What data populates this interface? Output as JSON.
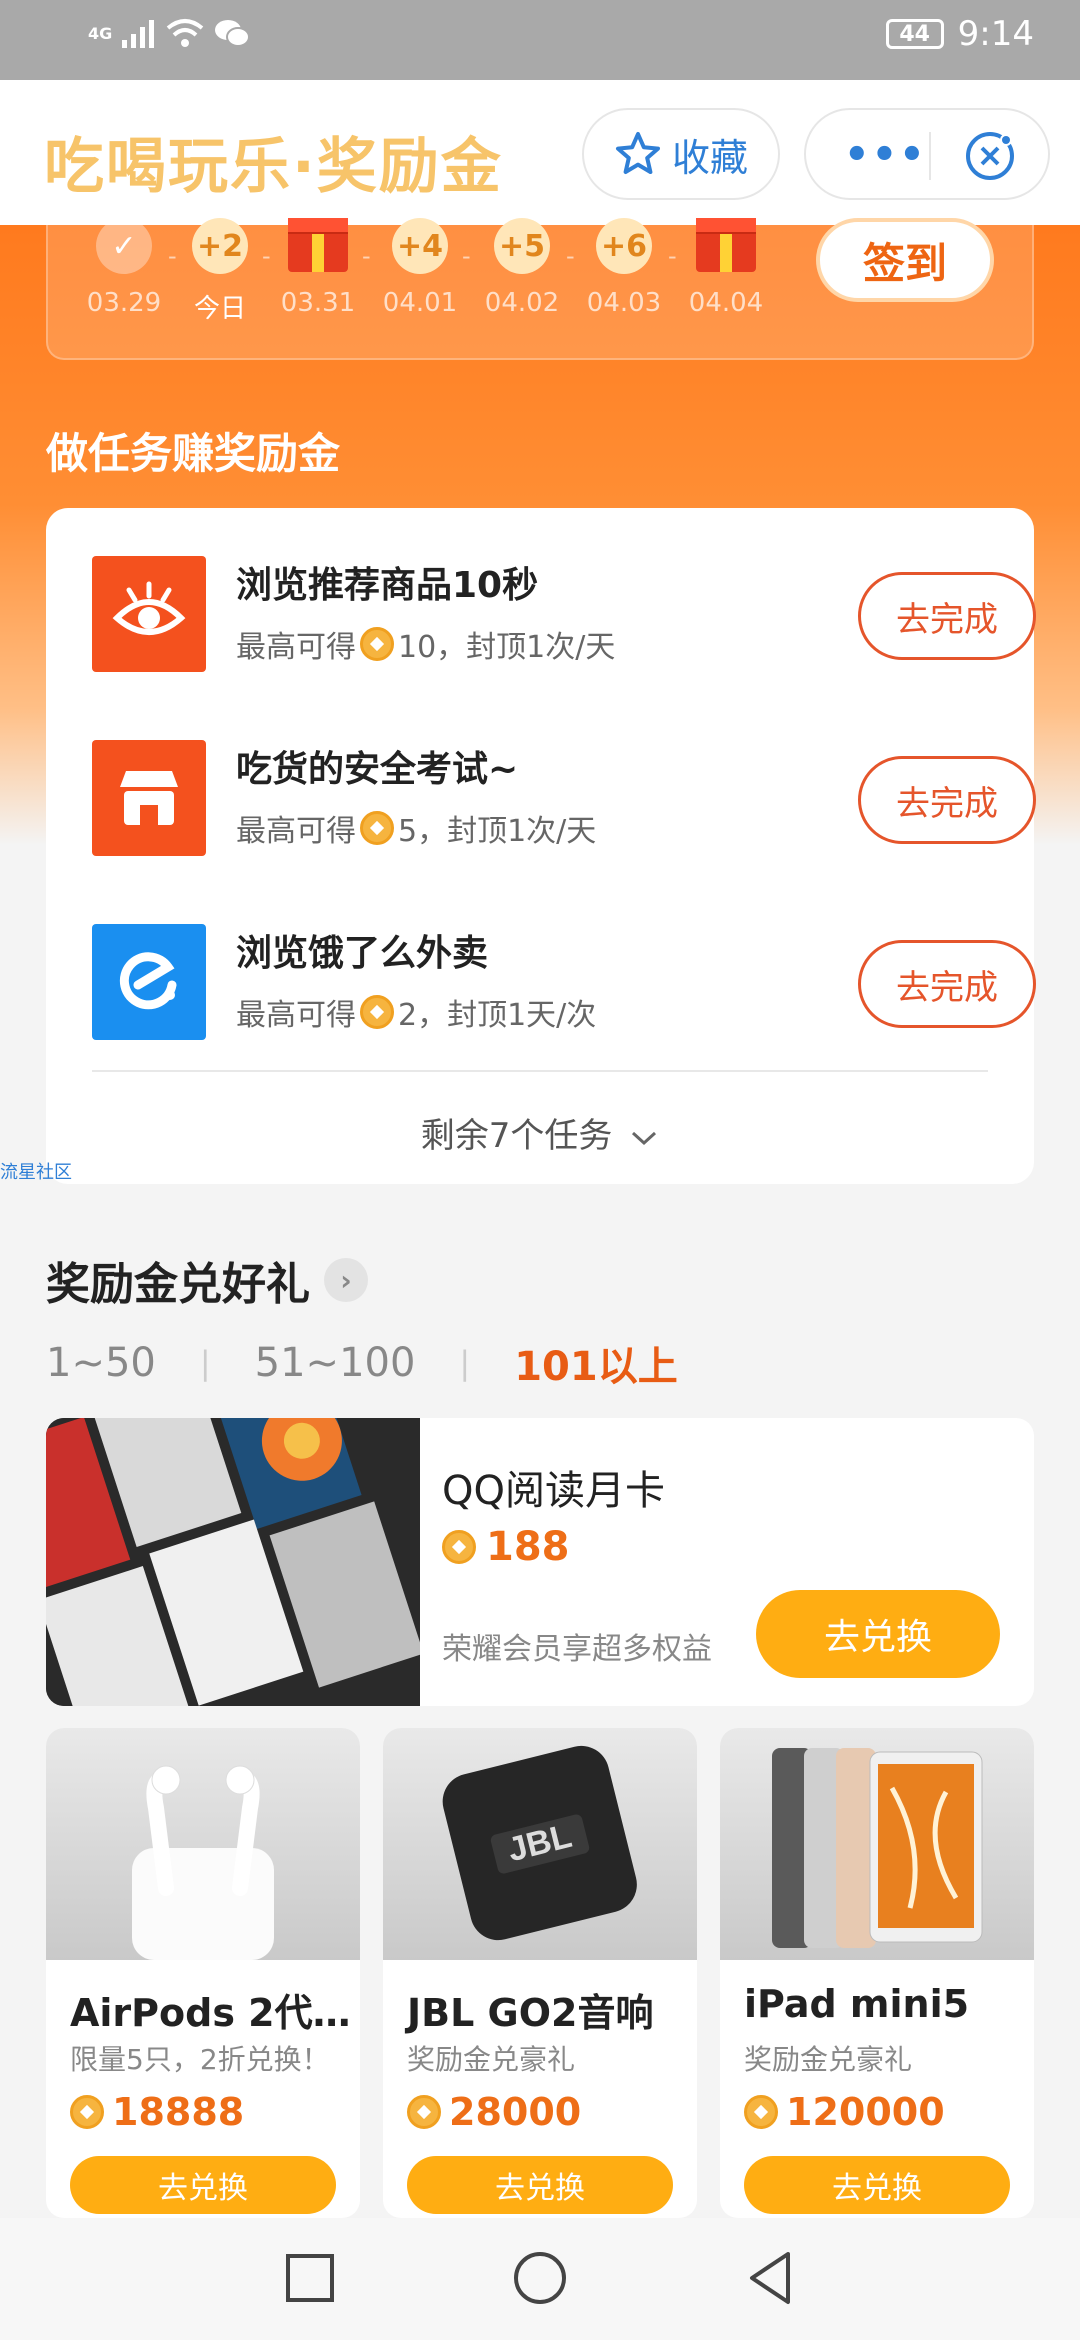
{
  "status_bar": {
    "network": "4G",
    "battery": "44",
    "time": "9:14"
  },
  "header": {
    "title": "吃喝玩乐·奖励金",
    "favorite_label": "收藏",
    "more_label": "•••"
  },
  "checkin": {
    "days": [
      {
        "reward": "✓",
        "date": "03.29",
        "type": "done"
      },
      {
        "reward": "+2",
        "date": "今日",
        "type": "today"
      },
      {
        "reward": "",
        "date": "03.31",
        "type": "gift"
      },
      {
        "reward": "+4",
        "date": "04.01",
        "type": "normal"
      },
      {
        "reward": "+5",
        "date": "04.02",
        "type": "normal"
      },
      {
        "reward": "+6",
        "date": "04.03",
        "type": "normal"
      },
      {
        "reward": "",
        "date": "04.04",
        "type": "gift"
      }
    ],
    "button_label": "签到"
  },
  "tasks": {
    "section_title": "做任务赚奖励金",
    "items": [
      {
        "name": "浏览推荐商品10秒",
        "prefix": "最高可得",
        "amount": "10，封顶1次/天",
        "button": "去完成",
        "icon": "eye-icon",
        "color": "#f4511e"
      },
      {
        "name": "吃货的安全考试~",
        "prefix": "最高可得",
        "amount": "5，封顶1次/天",
        "button": "去完成",
        "icon": "shop-icon",
        "color": "#f4511e"
      },
      {
        "name": "浏览饿了么外卖",
        "prefix": "最高可得",
        "amount": "2，封顶1天/次",
        "button": "去完成",
        "icon": "eleme-icon",
        "color": "#1a8ff0"
      }
    ],
    "more_label": "剩余7个任务"
  },
  "watermark": "流星社区",
  "rewards": {
    "section_title": "奖励金兑好礼",
    "ranges": [
      "1~50",
      "51~100",
      "101以上"
    ],
    "active_range": "101以上",
    "featured": {
      "name": "QQ阅读月卡",
      "price": "188",
      "subtitle": "荣耀会员享超多权益",
      "button": "去兑换"
    },
    "products": [
      {
        "name": "AirPods 2代…",
        "subtitle": "限量5只，2折兑换！",
        "price": "18888",
        "button": "去兑换"
      },
      {
        "name": "JBL GO2音响",
        "subtitle": "奖励金兑豪礼",
        "price": "28000",
        "button": "去兑换"
      },
      {
        "name": "iPad mini5",
        "subtitle": "奖励金兑豪礼",
        "price": "120000",
        "button": "去兑换"
      }
    ]
  },
  "colors": {
    "accent_orange": "#ee6e17",
    "button_yellow": "#ffad12",
    "task_border": "#e5552b",
    "link_blue": "#2f7fd6"
  }
}
